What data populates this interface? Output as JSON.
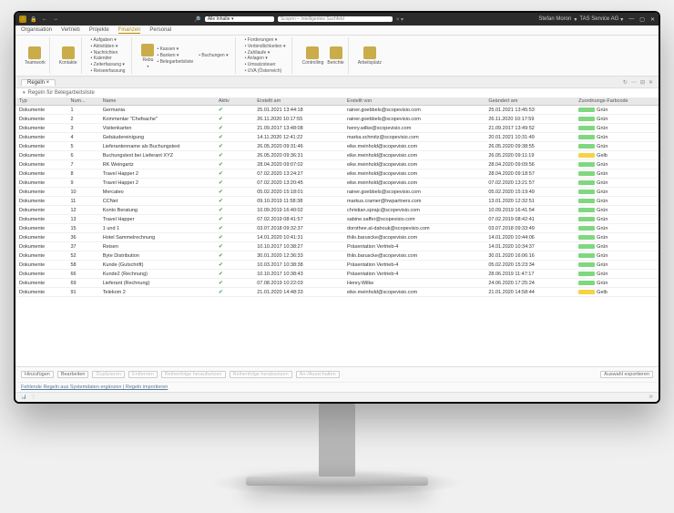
{
  "title": {
    "user": "Stefan Moron",
    "company": "TAS Service AG"
  },
  "search": {
    "scope": "Alle Inhalte",
    "placeholder": "Scopen – Intelligentes Suchfeld"
  },
  "menu": [
    "Organisation",
    "Vertrieb",
    "Projekte",
    "Finanzen",
    "Personal"
  ],
  "menu_active": "Finanzen",
  "ribbon": {
    "g1": {
      "big1": "Teamwork",
      "big2": "Kontakte"
    },
    "g2": [
      "Aufgaben ▾",
      "Aktivitäten ▾",
      "Nachrichten",
      "Kalender",
      "Zeiterfassung ▾",
      "Reiseerfassung"
    ],
    "g3": {
      "big": "Rebu",
      "items": [
        "Kassen ▾",
        "Banken ▾",
        "Belegarbeitsliste",
        "Buchungen ▾"
      ]
    },
    "g4": [
      "Forderungen ▾",
      "Verbindlichkeiten ▾",
      "Zahllaufe ▾",
      "Anlagen ▾",
      "Umsatzsteuer",
      "UVA (Österreich)"
    ],
    "g5": {
      "b1": "Controlling",
      "b2": "Berichte"
    },
    "g6": {
      "big": "Arbeitsplatz"
    }
  },
  "tab": "Regeln",
  "section": "Regeln für Belegarbeitsliste",
  "columns": [
    "Typ",
    "Num...",
    "Name",
    "Aktiv",
    "Erstellt am",
    "Erstellt von",
    "Geändert am",
    "Zuordnungs-Farbcode"
  ],
  "rows": [
    {
      "typ": "Dokumente",
      "num": "1",
      "name": "Germania",
      "aktiv": true,
      "erstellt_am": "25.01.2021 13:44:18",
      "erstellt_von": "rainer.goebbels@scopevisio.com",
      "geaendert_am": "25.01.2021 13:45:53",
      "cc": "Grün"
    },
    {
      "typ": "Dokumente",
      "num": "2",
      "name": "Kommentar \"Chefsache\"",
      "aktiv": true,
      "erstellt_am": "26.11.2020 10:17:55",
      "erstellt_von": "rainer.goebbels@scopevisio.com",
      "geaendert_am": "26.11.2020 10:17:59",
      "cc": "Grün"
    },
    {
      "typ": "Dokumente",
      "num": "3",
      "name": "Visitenkarten",
      "aktiv": true,
      "erstellt_am": "21.09.2017 13:48:08",
      "erstellt_von": "henry.wilke@scopevisio.com",
      "geaendert_am": "21.09.2017 13:49:52",
      "cc": "Grün"
    },
    {
      "typ": "Dokumente",
      "num": "4",
      "name": "Gebäudereinigung",
      "aktiv": true,
      "erstellt_am": "14.11.2020 12:41:22",
      "erstellt_von": "marka.schmitz@scopevisio.com",
      "geaendert_am": "20.01.2021 10:31:49",
      "cc": "Grün"
    },
    {
      "typ": "Dokumente",
      "num": "5",
      "name": "Lieferantenname als Buchungstext",
      "aktiv": true,
      "erstellt_am": "26.05.2020 09:31:46",
      "erstellt_von": "eike.meinhold@scopevisio.com",
      "geaendert_am": "26.05.2020 09:38:55",
      "cc": "Grün"
    },
    {
      "typ": "Dokumente",
      "num": "6",
      "name": "Buchungstext bei Lieferant XYZ",
      "aktiv": true,
      "erstellt_am": "26.05.2020 09:36:31",
      "erstellt_von": "eike.meinhold@scopevisio.com",
      "geaendert_am": "26.05.2020 09:11:19",
      "cc": "Gelb"
    },
    {
      "typ": "Dokumente",
      "num": "7",
      "name": "RK Weingartz",
      "aktiv": true,
      "erstellt_am": "28.04.2020 09:07:02",
      "erstellt_von": "eike.meinhold@scopevisio.com",
      "geaendert_am": "28.04.2020 09:09:56",
      "cc": "Grün"
    },
    {
      "typ": "Dokumente",
      "num": "8",
      "name": "Travel Happer 2",
      "aktiv": true,
      "erstellt_am": "07.02.2020 13:24:27",
      "erstellt_von": "eike.meinhold@scopevisio.com",
      "geaendert_am": "28.04.2020 09:18:57",
      "cc": "Grün"
    },
    {
      "typ": "Dokumente",
      "num": "9",
      "name": "Travel Happer 2",
      "aktiv": true,
      "erstellt_am": "07.02.2020 13:20:45",
      "erstellt_von": "eike.meinhold@scopevisio.com",
      "geaendert_am": "07.02.2020 13:21:57",
      "cc": "Grün"
    },
    {
      "typ": "Dokumente",
      "num": "10",
      "name": "Mercateo",
      "aktiv": true,
      "erstellt_am": "05.02.2020 15:18:01",
      "erstellt_von": "rainer.goebbels@scopevisio.com",
      "geaendert_am": "05.02.2020 15:19:49",
      "cc": "Grün"
    },
    {
      "typ": "Dokumente",
      "num": "11",
      "name": "CCNet",
      "aktiv": true,
      "erstellt_am": "09.10.2019 11:58:38",
      "erstellt_von": "markus.cramer@hwpartners.com",
      "geaendert_am": "13.01.2020 12:32:51",
      "cc": "Grün"
    },
    {
      "typ": "Dokumente",
      "num": "12",
      "name": "Konto Beratung",
      "aktiv": true,
      "erstellt_am": "10.09.2019 16:40:02",
      "erstellt_von": "christian.sprajc@scopevisio.com",
      "geaendert_am": "10.09.2019 16:41:54",
      "cc": "Grün"
    },
    {
      "typ": "Dokumente",
      "num": "13",
      "name": "Travel Happer",
      "aktiv": true,
      "erstellt_am": "07.02.2019 08:41:57",
      "erstellt_von": "sabine.saffer@scopevisio.com",
      "geaendert_am": "07.02.2019 08:42:41",
      "cc": "Grün"
    },
    {
      "typ": "Dokumente",
      "num": "15",
      "name": "1 und 1",
      "aktiv": true,
      "erstellt_am": "03.07.2018 09:32:37",
      "erstellt_von": "dorothee.al-dahouk@scopevisio.com",
      "geaendert_am": "03.07.2018 09:33:49",
      "cc": "Grün"
    },
    {
      "typ": "Dokumente",
      "num": "36",
      "name": "Hotel Sammelrechnung",
      "aktiv": true,
      "erstellt_am": "14.01.2020 10:41:31",
      "erstellt_von": "thilo.baruscke@scopevisio.com",
      "geaendert_am": "14.01.2020 10:44:06",
      "cc": "Grün"
    },
    {
      "typ": "Dokumente",
      "num": "37",
      "name": "Reisen",
      "aktiv": true,
      "erstellt_am": "10.10.2017 10:38:27",
      "erstellt_von": "Präsentation Vertrieb-4",
      "geaendert_am": "14.01.2020 10:34:37",
      "cc": "Grün"
    },
    {
      "typ": "Dokumente",
      "num": "52",
      "name": "Byte Distribution",
      "aktiv": true,
      "erstellt_am": "30.01.2020 12:36:33",
      "erstellt_von": "thilo.baruscke@scopevisio.com",
      "geaendert_am": "30.01.2020 16:06:16",
      "cc": "Grün"
    },
    {
      "typ": "Dokumente",
      "num": "58",
      "name": "Kunde (Gutschrift)",
      "aktiv": true,
      "erstellt_am": "10.03.2017 10:38:38",
      "erstellt_von": "Präsentation Vertrieb-4",
      "geaendert_am": "05.02.2020 15:23:34",
      "cc": "Grün"
    },
    {
      "typ": "Dokumente",
      "num": "66",
      "name": "Kunde2 (Rechnung)",
      "aktiv": true,
      "erstellt_am": "10.10.2017 10:38:43",
      "erstellt_von": "Präsentation Vertrieb-4",
      "geaendert_am": "28.06.2019 11:47:17",
      "cc": "Grün"
    },
    {
      "typ": "Dokumente",
      "num": "69",
      "name": "Lieferant (Rechnung)",
      "aktiv": true,
      "erstellt_am": "07.08.2019 10:22:03",
      "erstellt_von": "Henry.Wilke",
      "geaendert_am": "24.06.2020 17:25:24",
      "cc": "Grün"
    },
    {
      "typ": "Dokumente",
      "num": "91",
      "name": "Telekom 2",
      "aktiv": true,
      "erstellt_am": "21.01.2020 14:48:33",
      "erstellt_von": "eike.meinhold@scopevisio.com",
      "geaendert_am": "21.01.2020 14:58:44",
      "cc": "Gelb"
    }
  ],
  "footer": [
    "Hinzufügen",
    "Bearbeiten",
    "Duplizieren",
    "Entfernen",
    "Reihenfolge heraufsetzen",
    "Reihenfolge herabsetzen",
    "An-/Ausschalten"
  ],
  "footer_right": "Auswahl exportieren",
  "links": "Fehlende Regeln aus Systemdaten ergänzen | Regeln importieren"
}
